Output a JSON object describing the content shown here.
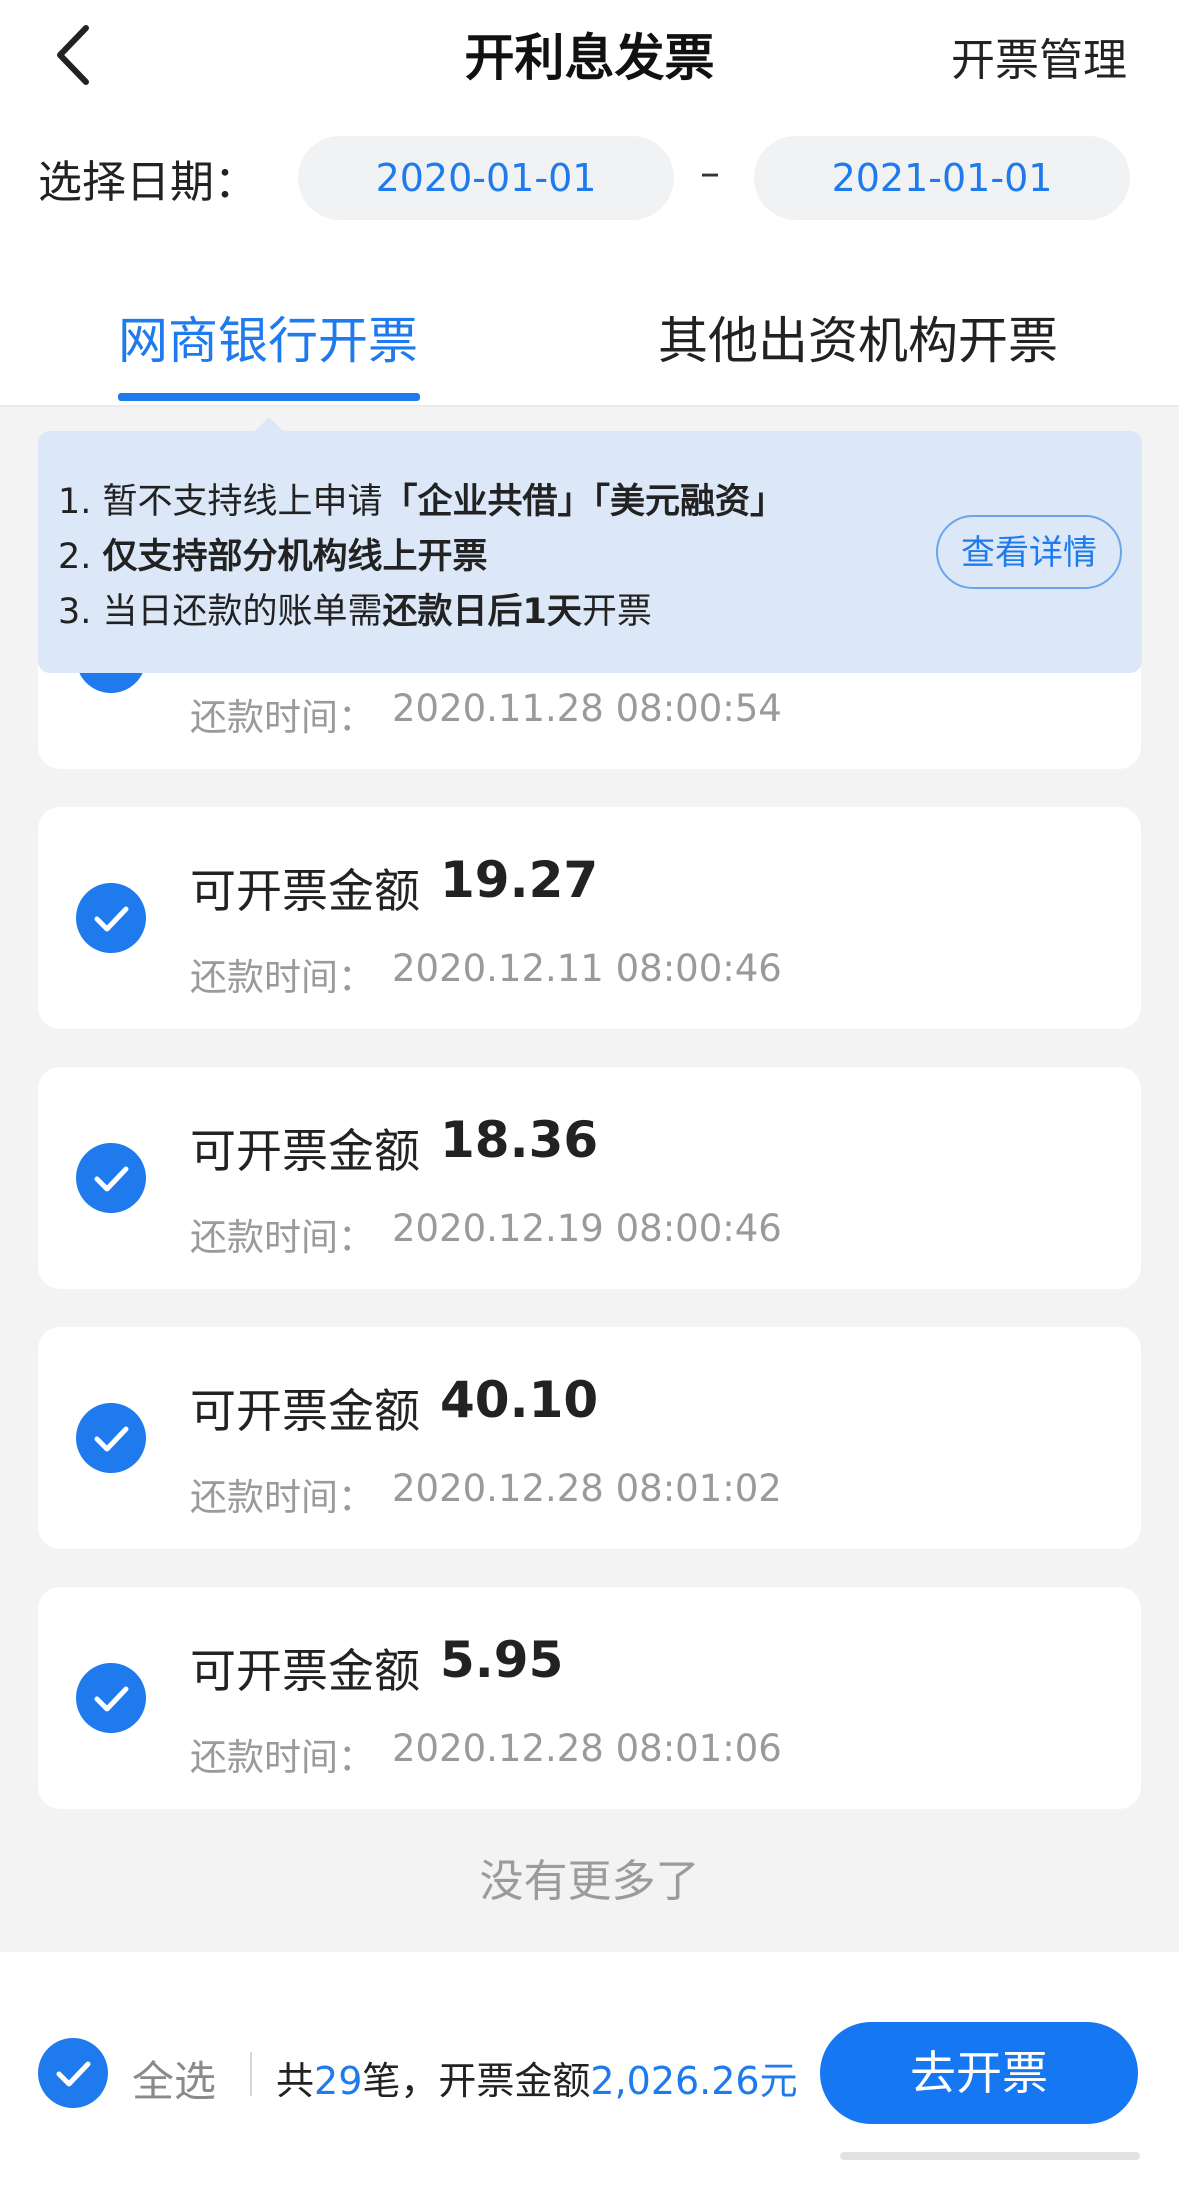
{
  "header": {
    "title": "开利息发票",
    "manage_label": "开票管理",
    "date_label": "选择日期：",
    "date_start": "2020-01-01",
    "date_separator": "–",
    "date_end": "2021-01-01"
  },
  "tabs": [
    {
      "label": "网商银行开票",
      "active": true
    },
    {
      "label": "其他出资机构开票",
      "active": false
    }
  ],
  "notice": {
    "line1_prefix": "1. 暂不支持线上申请",
    "line1_bold": "「企业共借」「美元融资」",
    "line2_prefix": "2. ",
    "line2_bold": "仅支持部分机构线上开票",
    "line3_prefix": "3. 当日还款的账单需",
    "line3_bold": "还款日后1天",
    "line3_suffix": "开票",
    "details_label": "查看详情"
  },
  "list": {
    "amount_label": "可开票金额",
    "time_label": "还款时间：",
    "items": [
      {
        "amount": "",
        "time": "2020.11.28 08:00:54",
        "checked": true
      },
      {
        "amount": "19.27",
        "time": "2020.12.11 08:00:46",
        "checked": true
      },
      {
        "amount": "18.36",
        "time": "2020.12.19 08:00:46",
        "checked": true
      },
      {
        "amount": "40.10",
        "time": "2020.12.28 08:01:02",
        "checked": true
      },
      {
        "amount": "5.95",
        "time": "2020.12.28 08:01:06",
        "checked": true
      }
    ],
    "end_text": "没有更多了"
  },
  "footer": {
    "select_all_label": "全选",
    "summary_prefix": "共",
    "count": "29",
    "summary_mid": "笔，开票金额",
    "total": "2,026.26元",
    "invoice_button": "去开票"
  },
  "colors": {
    "accent": "#1f7bed",
    "notice_bg": "#dce8f7",
    "page_bg": "#f3f3f4"
  }
}
